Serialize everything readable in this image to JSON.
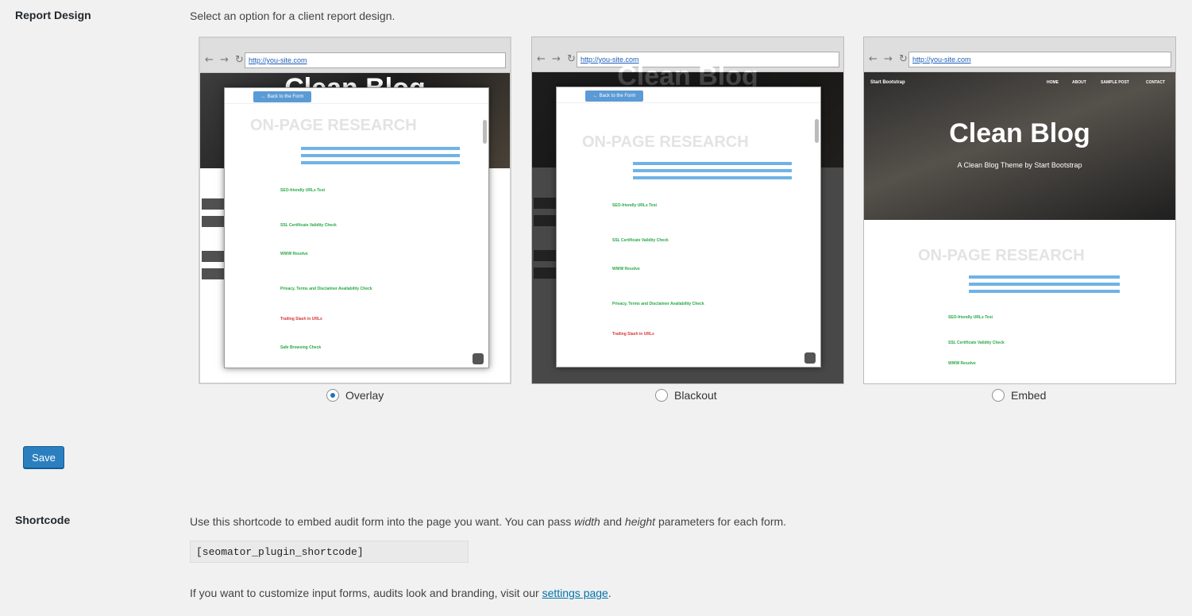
{
  "report_design": {
    "label": "Report Design",
    "description": "Select an option for a client report design.",
    "url_text": "http://you-site.com",
    "nav_arrows": "← → ↻",
    "preview_title": "Clean Blog",
    "preview_subtitle": "A Clean Blog Theme by Start Bootstrap",
    "brand": "Start Bootstrap",
    "nav": [
      "HOME",
      "ABOUT",
      "SAMPLE POST",
      "CONTACT"
    ],
    "back_button": "← Back to the Form",
    "research_heading": "ON-PAGE RESEARCH",
    "items": [
      "SEO-friendly URLs Test",
      "SSL Certificate Validity Check",
      "WWW Resolve",
      "Privacy, Terms and Disclaimer Availability Check",
      "Trailing Slash in URLs",
      "Safe Browsing Check"
    ],
    "options": [
      {
        "label": "Overlay",
        "selected": true
      },
      {
        "label": "Blackout",
        "selected": false
      },
      {
        "label": "Embed",
        "selected": false
      }
    ]
  },
  "save_label": "Save",
  "shortcode": {
    "label": "Shortcode",
    "desc_part1": "Use this shortcode to embed audit form into the page you want. You can pass ",
    "desc_width": "width",
    "desc_and": " and ",
    "desc_height": "height",
    "desc_part2": " parameters for each form.",
    "code": "[seomator_plugin_shortcode]",
    "customize_prefix": "If you want to customize input forms, audits look and branding, visit our ",
    "customize_link": "settings page",
    "customize_suffix": "."
  },
  "colors": {
    "accent": "#2b7fbf",
    "link": "#0073aa",
    "pass": "#27a844",
    "fail": "#d63638",
    "bar": "#6fb3e6"
  }
}
